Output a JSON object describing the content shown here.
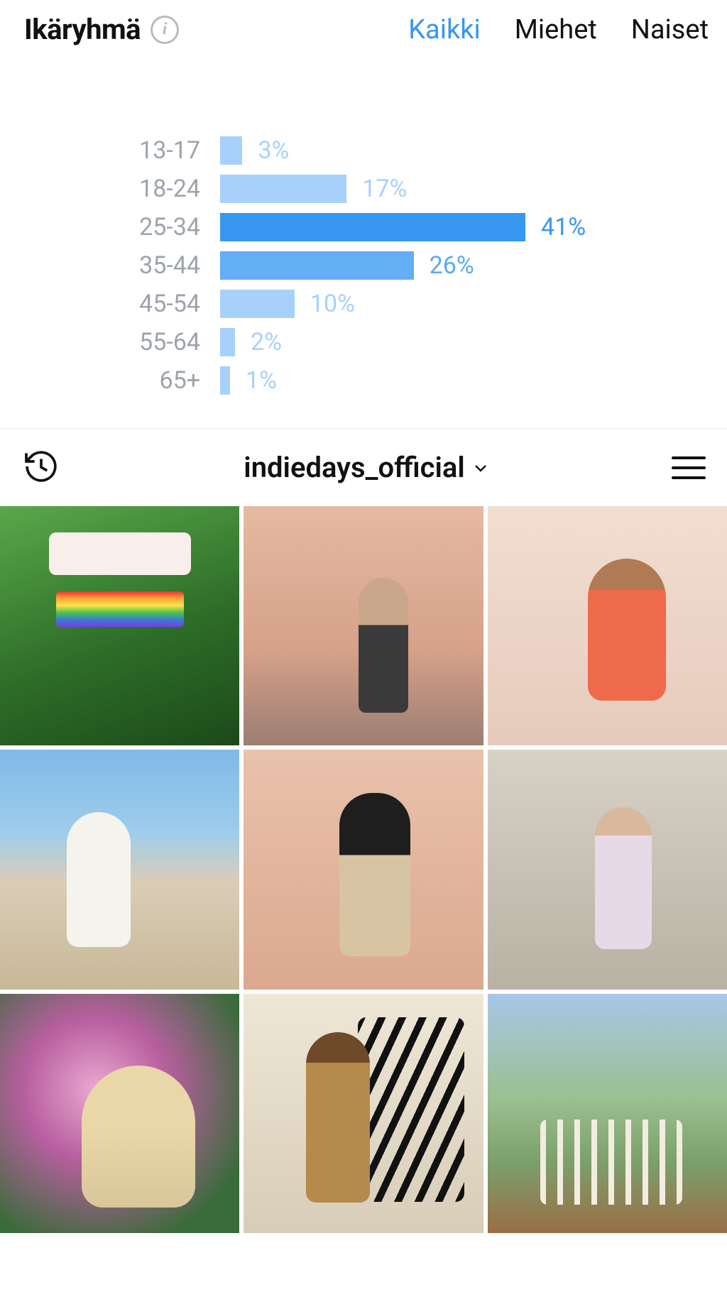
{
  "analytics": {
    "title": "Ikäryhmä",
    "tabs": {
      "all": "Kaikki",
      "men": "Miehet",
      "women": "Naiset",
      "active": "all"
    }
  },
  "chart_data": {
    "type": "bar",
    "orientation": "horizontal",
    "title": "Ikäryhmä",
    "xlabel": "%",
    "ylabel": "ikäryhmä",
    "xlim": [
      0,
      41
    ],
    "categories": [
      "13-17",
      "18-24",
      "25-34",
      "35-44",
      "45-54",
      "55-64",
      "65+"
    ],
    "values": [
      3,
      17,
      41,
      26,
      10,
      2,
      1
    ],
    "value_suffix": "%",
    "colors": {
      "default_bar": "#a7d1fb",
      "default_text": "#a7d1fb",
      "highlight_bar": "#3897f0",
      "highlight_text": "#3897f0"
    },
    "highlight_index": 2,
    "semi_highlight_index": 3
  },
  "profile": {
    "username": "indiedays_official"
  },
  "grid": {
    "count": 9
  }
}
